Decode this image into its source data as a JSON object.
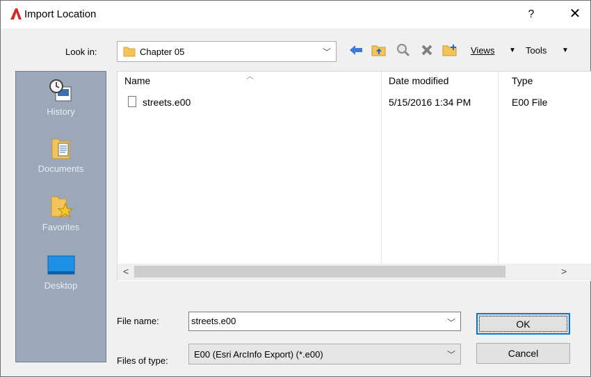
{
  "window": {
    "title": "Import Location",
    "help_glyph": "?",
    "close_glyph": "✕"
  },
  "toolbar": {
    "look_in_label": "Look in:",
    "look_in_value": "Chapter 05",
    "views_label": "Views",
    "tools_label": "Tools",
    "icons": [
      "back-arrow-icon",
      "up-folder-icon",
      "search-web-icon",
      "delete-icon",
      "new-folder-icon"
    ]
  },
  "places": [
    {
      "label": "History",
      "icon": "history-icon"
    },
    {
      "label": "Documents",
      "icon": "documents-icon"
    },
    {
      "label": "Favorites",
      "icon": "favorites-icon"
    },
    {
      "label": "Desktop",
      "icon": "desktop-icon"
    }
  ],
  "file_list": {
    "columns": [
      "Name",
      "Date modified",
      "Type"
    ],
    "rows": [
      {
        "name": "streets.e00",
        "date": "5/15/2016 1:34 PM",
        "type": "E00 File"
      }
    ]
  },
  "file_name": {
    "label": "File name:",
    "value": "streets.e00"
  },
  "files_of_type": {
    "label": "Files of type:",
    "value": "E00 (Esri ArcInfo Export) (*.e00)"
  },
  "buttons": {
    "ok": "OK",
    "cancel": "Cancel"
  },
  "colors": {
    "places_bg": "#9aa8ba",
    "accent": "#0078d7",
    "app_logo": "#d42a2a",
    "folder": "#f2c45a"
  }
}
